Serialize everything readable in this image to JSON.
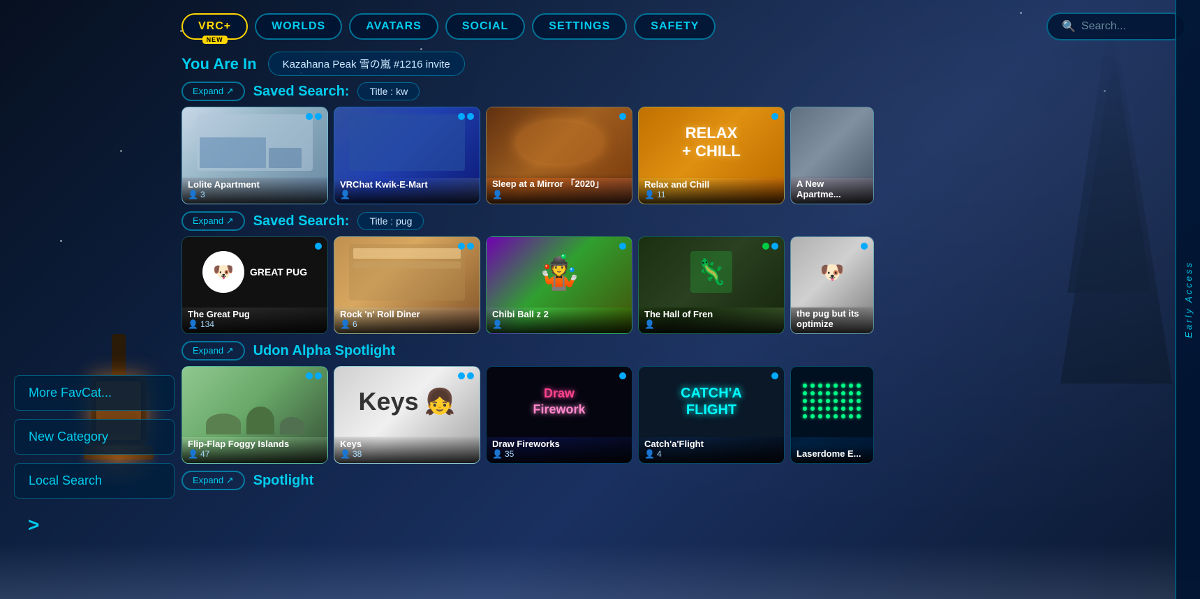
{
  "nav": {
    "vrc_plus": "VRC+",
    "vrc_badge": "NEW",
    "worlds": "WORLDS",
    "avatars": "AVATARS",
    "social": "SOCIAL",
    "settings": "SETTINGS",
    "safety": "SAFETY",
    "search_placeholder": "Search..."
  },
  "early_access": "Early Access",
  "you_are_in": {
    "label": "You Are In",
    "location": "Kazahana Peak 雪の嵐 #1216 invite"
  },
  "sections": [
    {
      "id": "saved_kw",
      "expand_label": "Expand ↗",
      "title_prefix": "Saved Search:",
      "search_tag": "Title : kw",
      "worlds": [
        {
          "name": "Lolite Apartment",
          "users": "3",
          "card_class": "card-lolite",
          "dots": 2
        },
        {
          "name": "VRChat Kwik-E-Mart",
          "users": "",
          "card_class": "card-kwik",
          "dots": 2
        },
        {
          "name": "Sleep at a Mirror 「2020」",
          "users": "",
          "card_class": "card-sleep",
          "dots": 1
        },
        {
          "name": "Relax and Chill",
          "users": "11",
          "card_class": "card-relax",
          "dots": 1
        },
        {
          "name": "A New Apartme...",
          "users": "",
          "card_class": "card-apartment",
          "dots": 0
        }
      ]
    },
    {
      "id": "saved_pug",
      "expand_label": "Expand ↗",
      "title_prefix": "Saved Search:",
      "search_tag": "Title : pug",
      "worlds": [
        {
          "name": "The Great Pug",
          "users": "134",
          "card_class": "card-greatpug",
          "dots": 1
        },
        {
          "name": "Rock 'n' Roll Diner",
          "users": "6",
          "card_class": "card-rocknroll",
          "dots": 2
        },
        {
          "name": "Chibi Ball z 2",
          "users": "",
          "card_class": "card-chibi",
          "dots": 1
        },
        {
          "name": "The Hall of Fren",
          "users": "",
          "card_class": "card-hallfren",
          "dots": 1
        },
        {
          "name": "the pug but its optimize",
          "users": "",
          "card_class": "card-pugbut",
          "dots": 1
        }
      ]
    },
    {
      "id": "udon",
      "expand_label": "Expand ↗",
      "title": "Udon Alpha Spotlight",
      "worlds": [
        {
          "name": "Flip-Flap Foggy Islands",
          "users": "47",
          "card_class": "card-flipflap",
          "dots": 2
        },
        {
          "name": "Keys",
          "users": "38",
          "card_class": "card-keys",
          "dots": 2
        },
        {
          "name": "Draw Fireworks",
          "users": "35",
          "card_class": "card-draw",
          "dots": 1
        },
        {
          "name": "Catch'a'Flight",
          "users": "4",
          "card_class": "card-catcha",
          "dots": 1
        },
        {
          "name": "Laserdome E...",
          "users": "",
          "card_class": "card-laser",
          "dots": 0
        }
      ]
    },
    {
      "id": "spotlight",
      "expand_label": "Expand ↗",
      "title": "Spotlight",
      "worlds": []
    }
  ],
  "sidebar": {
    "more_favcats": "More FavCat...",
    "new_category": "New Category",
    "local_search": "Local Search",
    "arrow": ">"
  }
}
